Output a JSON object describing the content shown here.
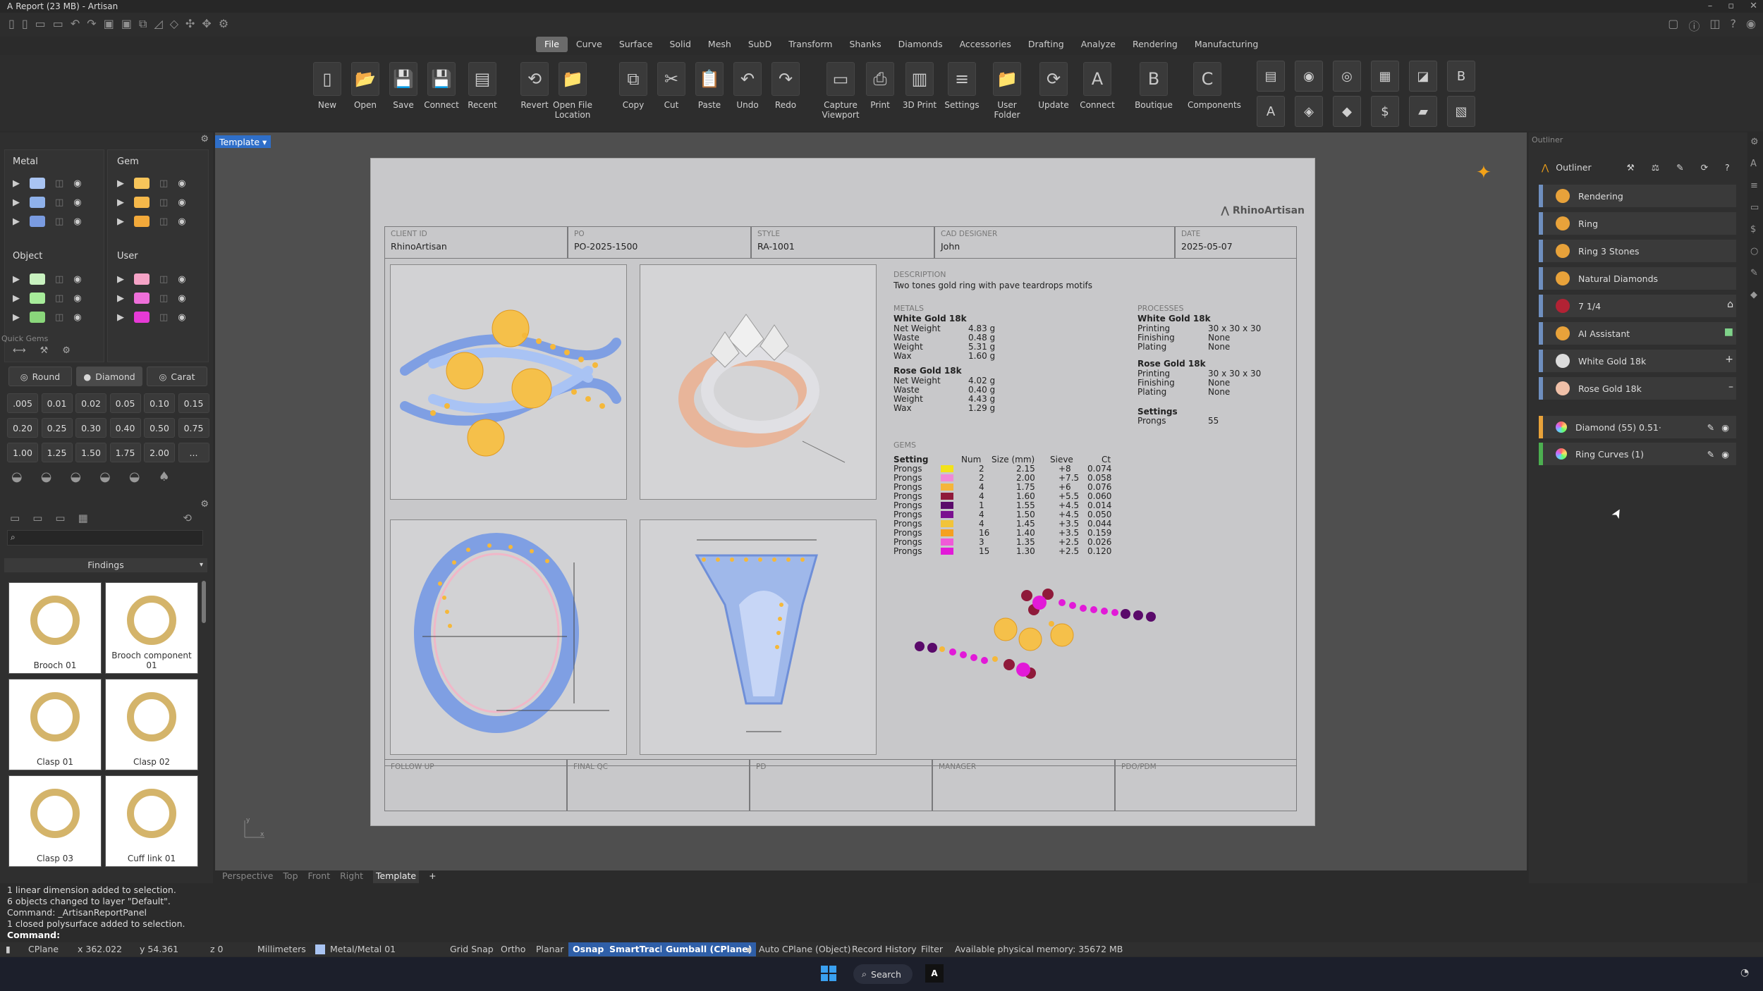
{
  "window": {
    "title": "Report (23 MB) - Artisan"
  },
  "menu_tabs": [
    "File",
    "Curve",
    "Surface",
    "Solid",
    "Mesh",
    "SubD",
    "Transform",
    "Shanks",
    "Diamonds",
    "Accessories",
    "Drafting",
    "Analyze",
    "Rendering",
    "Manufacturing"
  ],
  "active_tab": "File",
  "ribbon": [
    "New",
    "Open",
    "Save",
    "Connect",
    "Recent",
    "Revert",
    "Open File Location",
    "Copy",
    "Cut",
    "Paste",
    "Undo",
    "Redo",
    "Capture Viewport",
    "Print",
    "3D Print",
    "Settings",
    "User Folder",
    "Update",
    "Connect",
    "Boutique",
    "Components"
  ],
  "ribbon_glyphs": [
    "▯",
    "📂",
    "💾",
    "💾",
    "▤",
    "⟲",
    "📁",
    "⧉",
    "✂",
    "📋",
    "↶",
    "↷",
    "▭",
    "⎙",
    "▥",
    "≡",
    "📁",
    "⟳",
    "A",
    "B",
    "C"
  ],
  "layers": {
    "metal": {
      "title": "Metal",
      "colors": [
        "#a9c4f2",
        "#8fb1ea",
        "#7a9be0"
      ]
    },
    "gem": {
      "title": "Gem",
      "colors": [
        "#f7c55a",
        "#f5b84a",
        "#f2a93a"
      ]
    },
    "object": {
      "title": "Object",
      "colors": [
        "#c9f2c0",
        "#a7ec9a",
        "#8ad77b"
      ]
    },
    "user": {
      "title": "User",
      "colors": [
        "#f5a3c6",
        "#ee6fd9",
        "#e63ad6"
      ]
    }
  },
  "quick_gems": {
    "title": "Quick Gems",
    "shape_buttons": [
      "Round",
      "Diamond",
      "Carat"
    ],
    "sizes": [
      ".005",
      "0.01",
      "0.02",
      "0.05",
      "0.10",
      "0.15",
      "0.20",
      "0.25",
      "0.30",
      "0.40",
      "0.50",
      "0.75",
      "1.00",
      "1.25",
      "1.50",
      "1.75",
      "2.00",
      "..."
    ]
  },
  "findings": {
    "header": "Findings",
    "items": [
      "Brooch 01",
      "Brooch component 01",
      "Clasp 01",
      "Clasp 02",
      "Clasp 03",
      "Cuff link 01"
    ]
  },
  "viewport": {
    "template_tab": "Template",
    "view_tabs": [
      "Perspective",
      "Top",
      "Front",
      "Right",
      "Template"
    ],
    "active_view": "Template"
  },
  "report": {
    "brand": "RhinoArtisan",
    "header_fields": [
      {
        "label": "CLIENT ID",
        "value": "RhinoArtisan"
      },
      {
        "label": "PO",
        "value": "PO-2025-1500"
      },
      {
        "label": "STYLE",
        "value": "RA-1001"
      },
      {
        "label": "CAD DESIGNER",
        "value": "John"
      },
      {
        "label": "DATE",
        "value": "2025-05-07"
      }
    ],
    "description_label": "DESCRIPTION",
    "description": "Two tones gold ring with pave teardrops motifs",
    "metals_label": "METALS",
    "metals": [
      {
        "name": "White Gold 18k",
        "rows": [
          [
            "Net Weight",
            "4.83 g"
          ],
          [
            "Waste",
            "0.48 g"
          ],
          [
            "Weight",
            "5.31 g"
          ],
          [
            "Wax",
            "1.60 g"
          ]
        ]
      },
      {
        "name": "Rose Gold 18k",
        "rows": [
          [
            "Net Weight",
            "4.02 g"
          ],
          [
            "Waste",
            "0.40 g"
          ],
          [
            "Weight",
            "4.43 g"
          ],
          [
            "Wax",
            "1.29 g"
          ]
        ]
      }
    ],
    "processes_label": "PROCESSES",
    "processes": [
      {
        "name": "White Gold 18k",
        "rows": [
          [
            "Printing",
            "30 x 30 x 30"
          ],
          [
            "Finishing",
            "None"
          ],
          [
            "Plating",
            "None"
          ]
        ]
      },
      {
        "name": "Rose Gold 18k",
        "rows": [
          [
            "Printing",
            "30 x 30 x 30"
          ],
          [
            "Finishing",
            "None"
          ],
          [
            "Plating",
            "None"
          ]
        ]
      }
    ],
    "settings_label": "Settings",
    "prongs_label": "Prongs",
    "prongs_value": "55",
    "gems_label": "GEMS",
    "gem_headers": [
      "Setting",
      "Num",
      "Size (mm)",
      "Sieve",
      "Ct"
    ],
    "gems": [
      {
        "setting": "Prongs",
        "color": "#f2e21a",
        "num": "2",
        "size": "2.15",
        "sieve": "+8",
        "ct": "0.074"
      },
      {
        "setting": "Prongs",
        "color": "#f089d6",
        "num": "2",
        "size": "2.00",
        "sieve": "+7.5",
        "ct": "0.058"
      },
      {
        "setting": "Prongs",
        "color": "#f5b53a",
        "num": "4",
        "size": "1.75",
        "sieve": "+6",
        "ct": "0.076"
      },
      {
        "setting": "Prongs",
        "color": "#8f1a3a",
        "num": "4",
        "size": "1.60",
        "sieve": "+5.5",
        "ct": "0.060"
      },
      {
        "setting": "Prongs",
        "color": "#5a0a6a",
        "num": "1",
        "size": "1.55",
        "sieve": "+4.5",
        "ct": "0.014"
      },
      {
        "setting": "Prongs",
        "color": "#7a1090",
        "num": "4",
        "size": "1.50",
        "sieve": "+4.5",
        "ct": "0.050"
      },
      {
        "setting": "Prongs",
        "color": "#f2c43a",
        "num": "4",
        "size": "1.45",
        "sieve": "+3.5",
        "ct": "0.044"
      },
      {
        "setting": "Prongs",
        "color": "#f5a020",
        "num": "16",
        "size": "1.40",
        "sieve": "+3.5",
        "ct": "0.159"
      },
      {
        "setting": "Prongs",
        "color": "#f05ad8",
        "num": "3",
        "size": "1.35",
        "sieve": "+2.5",
        "ct": "0.026"
      },
      {
        "setting": "Prongs",
        "color": "#e21ad8",
        "num": "15",
        "size": "1.30",
        "sieve": "+2.5",
        "ct": "0.120"
      }
    ],
    "footer_fields": [
      "FOLLOW UP",
      "FINAL QC",
      "PD",
      "MANAGER",
      "PDO/PDM"
    ]
  },
  "outliner": {
    "title": "Outliner",
    "panel_label": "Outliner",
    "items": [
      {
        "label": "Rendering",
        "icon_color": "#e8a23a"
      },
      {
        "label": "Ring",
        "icon_color": "#e8a23a"
      },
      {
        "label": "Ring 3 Stones",
        "icon_color": "#e8a23a"
      },
      {
        "label": "Natural Diamonds",
        "icon_color": "#e8a23a"
      },
      {
        "label": "7 1/4",
        "icon_color": "#b22234"
      },
      {
        "label": "AI Assistant",
        "icon_color": "#e8a23a"
      },
      {
        "label": "White Gold 18k",
        "icon_color": "#dcdcdc"
      },
      {
        "label": "Rose Gold 18k",
        "icon_color": "#f0c0a8"
      }
    ],
    "objects": [
      {
        "label": "Diamond (55) 0.51·",
        "bar": "#e8a23a"
      },
      {
        "label": "Ring Curves (1)",
        "bar": "#4caf50"
      }
    ]
  },
  "command_history": [
    "1 linear dimension added to selection.",
    "6 objects changed to layer \"Default\".",
    "Command: _ArtisanReportPanel",
    "1 closed polysurface added to selection."
  ],
  "command_prompt": "Command:",
  "statusbar": {
    "cplane": "CPlane",
    "x": "x 362.022",
    "y": "y 54.361",
    "z": "z 0",
    "units": "Millimeters",
    "layer": "Metal/Metal 01",
    "grid_snap": "Grid Snap",
    "ortho": "Ortho",
    "planar": "Planar",
    "osnap": "Osnap",
    "smarttrack": "SmartTrack",
    "gumball": "Gumball (CPlane)",
    "auto_cplane": "Auto CPlane (Object)",
    "record_history": "Record History",
    "filter": "Filter",
    "memory": "Available physical memory: 35672 MB"
  },
  "taskbar": {
    "search": "Search"
  }
}
